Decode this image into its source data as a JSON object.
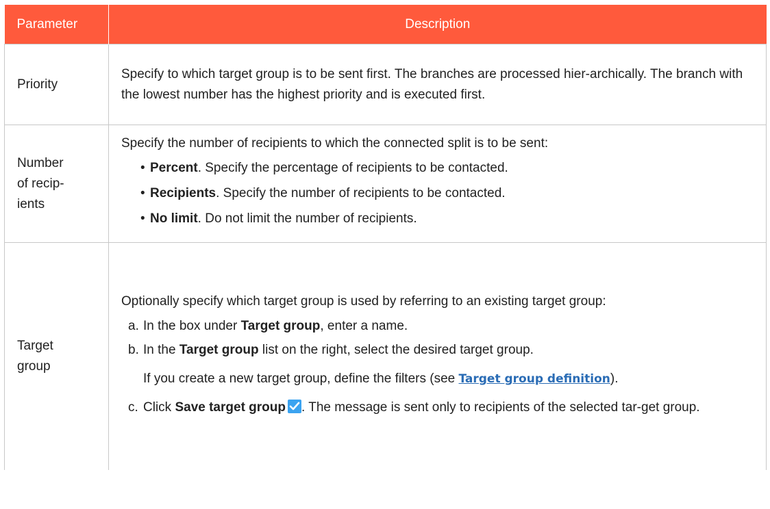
{
  "header": {
    "parameter": "Parameter",
    "description": "Description"
  },
  "priority": {
    "name": "Priority",
    "description": "Specify to which target group is to be sent first. The branches are processed hier-archically. The branch with the lowest number has the highest priority and is executed first."
  },
  "recipients": {
    "name_line1": "Number",
    "name_line2": "of recip-",
    "name_line3": "ients",
    "intro": "Specify the number of recipients to which the connected split is to be sent:",
    "options": [
      {
        "label": "Percent",
        "text": ". Specify the percentage of recipients to be contacted."
      },
      {
        "label": "Recipients",
        "text": ". Specify the number of recipients to be contacted."
      },
      {
        "label": "No limit",
        "text": ". Do not limit the number of recipients."
      }
    ]
  },
  "target_group": {
    "name_line1": "Target",
    "name_line2": "group",
    "intro": "Optionally specify which target group is used by referring to an existing target group:",
    "step_a": {
      "marker": "a.",
      "pre": "In the box under ",
      "bold": "Target group",
      "post": ", enter a name."
    },
    "step_b": {
      "marker": "b.",
      "pre": "In the ",
      "bold": "Target group",
      "post": " list on the right, select the desired target group."
    },
    "note": {
      "pre": "If you create a new target group, define the filters (see ",
      "link": "Target group definition",
      "post": ")."
    },
    "step_c": {
      "marker": "c.",
      "pre": "Click ",
      "bold": "Save target group",
      "post": ". The message is sent only to recipients of the selected tar-get group."
    },
    "save_icon": "checkmark-icon",
    "accent_color": "#3ba3f0"
  },
  "colors": {
    "header_bg": "#ff5a3c",
    "link": "#2a6cb5",
    "border": "#c8c8c8"
  }
}
